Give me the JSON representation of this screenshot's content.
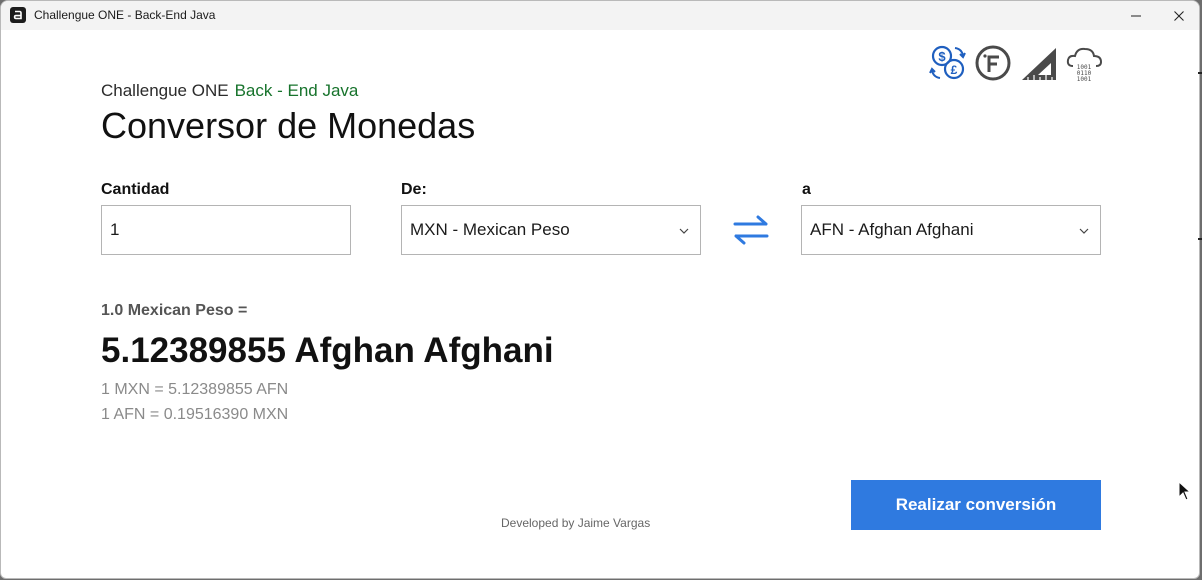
{
  "window": {
    "title": "Challengue ONE - Back-End Java",
    "minimize_symbol": "—",
    "close_symbol": "✕"
  },
  "header": {
    "subtitle_prefix": "Challengue ONE",
    "subtitle_accent": "Back - End Java",
    "title": "Conversor de Monedas",
    "accent_color": "#17732c"
  },
  "brand_icons": [
    "currency-exchange-icon",
    "f-circle-icon",
    "set-square-icon",
    "cloud-binary-icon"
  ],
  "form": {
    "amount_label": "Cantidad",
    "amount_value": "1",
    "from_label": "De:",
    "from_value": "MXN - Mexican Peso",
    "to_label": "a",
    "to_value": "AFN - Afghan Afghani"
  },
  "result": {
    "from_text": "1.0 Mexican Peso  =",
    "value_text": "5.12389855 Afghan Afghani",
    "rate_forward": "1  MXN = 5.12389855  AFN",
    "rate_reverse": "1  AFN = 0.19516390  MXN"
  },
  "footer": {
    "credit": "Developed by Jaime Vargas",
    "convert_button": "Realizar conversión",
    "button_color": "#2f7ae0"
  }
}
